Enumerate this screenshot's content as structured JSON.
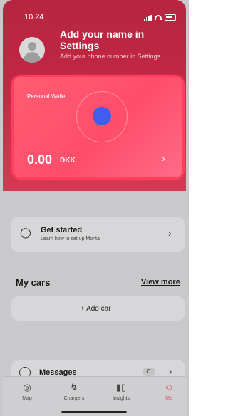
{
  "status_bar": {
    "time": "10.24"
  },
  "profile": {
    "name": "Add your name in Settings",
    "phone": "Add your phone number in Settings"
  },
  "wallet": {
    "title": "Personal Wallet",
    "balance": "0.00",
    "currency": "DKK"
  },
  "get_started": {
    "title": "Get started",
    "subtitle": "Learn how to set up Monta"
  },
  "cars": {
    "title": "My cars",
    "view_more": "View more",
    "add_car": "+ Add car"
  },
  "messages": {
    "label": "Messages",
    "count": "0"
  },
  "tabs": [
    {
      "label": "Map",
      "icon": "map-pin-icon"
    },
    {
      "label": "Chargers",
      "icon": "bolt-icon"
    },
    {
      "label": "Insights",
      "icon": "bar-chart-icon"
    },
    {
      "label": "Me",
      "icon": "user-icon",
      "active": true
    }
  ],
  "colors": {
    "accent": "#e2445f",
    "header": "#c02744",
    "wallet": "#ff5d73",
    "wallet_dot": "#3f5ef1"
  }
}
